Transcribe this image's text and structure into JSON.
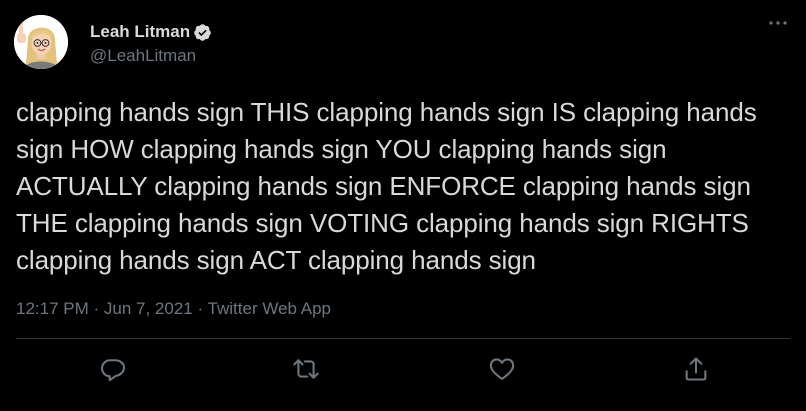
{
  "author": {
    "display_name": "Leah Litman",
    "handle": "@LeahLitman",
    "verified": true,
    "avatar_icon": "bitmoji-avatar-icon"
  },
  "tweet": {
    "text": "clapping hands sign THIS clapping hands sign IS clapping hands sign HOW clapping hands sign YOU clapping hands sign ACTUALLY clapping hands sign ENFORCE clapping hands sign THE clapping hands sign VOTING clapping hands sign RIGHTS clapping hands sign ACT clapping hands sign",
    "time": "12:17 PM",
    "separator": " · ",
    "date": "Jun 7, 2021",
    "source": "Twitter Web App"
  },
  "actions": [
    {
      "name": "reply",
      "icon": "reply-icon"
    },
    {
      "name": "retweet",
      "icon": "retweet-icon"
    },
    {
      "name": "like",
      "icon": "heart-icon"
    },
    {
      "name": "share",
      "icon": "share-icon"
    }
  ],
  "colors": {
    "background": "#000000",
    "primary_text": "#d9d9d9",
    "secondary_text": "#6e767d",
    "divider": "#2f3336",
    "verified_badge": "#d9d9d9"
  }
}
